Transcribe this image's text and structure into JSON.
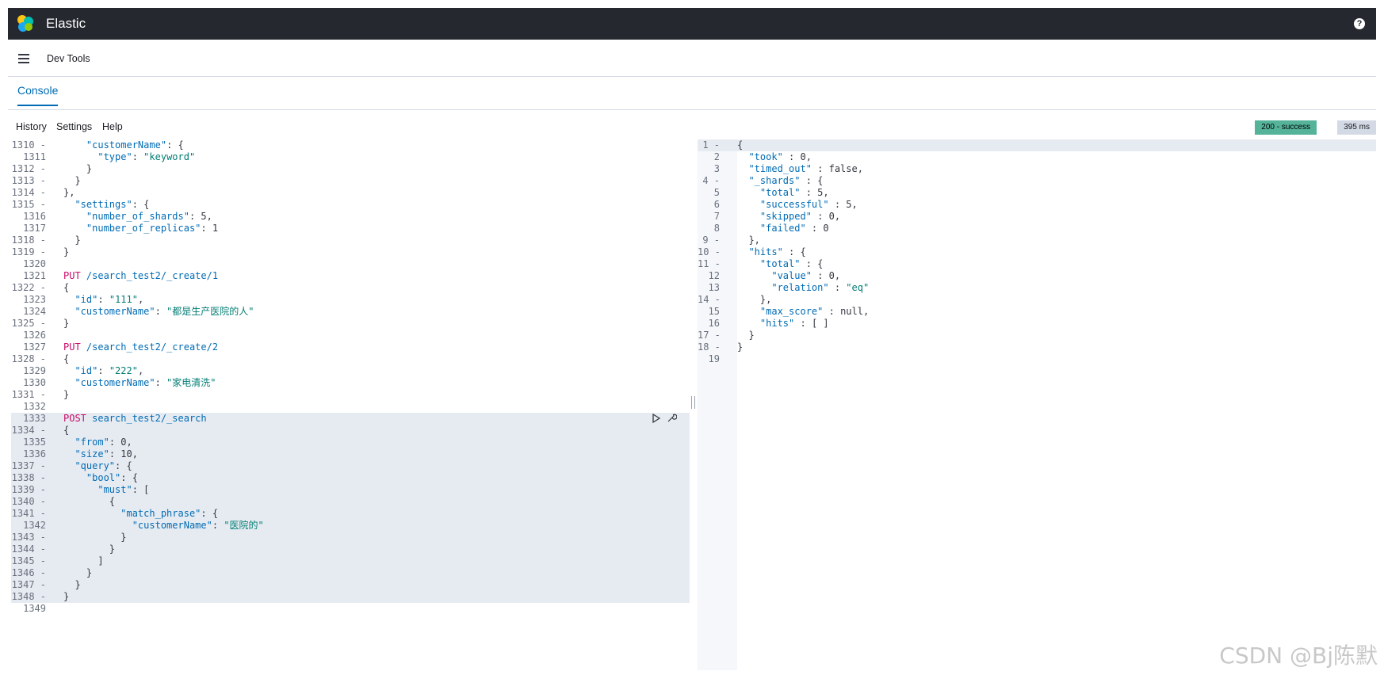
{
  "app": {
    "title": "Elastic"
  },
  "header": {
    "breadcrumb": "Dev Tools",
    "help_label": "?"
  },
  "tabs": [
    {
      "label": "Console",
      "active": true
    }
  ],
  "toolbar": {
    "history": "History",
    "settings": "Settings",
    "help": "Help",
    "status": "200 - success",
    "time": "395 ms"
  },
  "colors": {
    "topbar": "#25282f",
    "accent": "#006bb4",
    "status_bg": "#54b399",
    "method": "#c80a68",
    "string": "#017d73"
  },
  "icons": [
    "menu-icon",
    "elastic-logo",
    "help-icon",
    "run-request-icon",
    "wrench-icon"
  ],
  "editor": {
    "lines": [
      {
        "n": "1310 -",
        "t": "    \"customerName\": {"
      },
      {
        "n": "1311",
        "t": "      \"type\": \"keyword\""
      },
      {
        "n": "1312 -",
        "t": "    }"
      },
      {
        "n": "1313 -",
        "t": "  }"
      },
      {
        "n": "1314 -",
        "t": "},",
        "indent": 1
      },
      {
        "n": "1315 -",
        "t": "  \"settings\": {"
      },
      {
        "n": "1316",
        "t": "    \"number_of_shards\": 5,"
      },
      {
        "n": "1317",
        "t": "    \"number_of_replicas\": 1"
      },
      {
        "n": "1318 -",
        "t": "  }"
      },
      {
        "n": "1319 -",
        "t": "}"
      },
      {
        "n": "1320",
        "t": ""
      },
      {
        "n": "1321",
        "t": "PUT /search_test2/_create/1",
        "method": "PUT"
      },
      {
        "n": "1322 -",
        "t": "{"
      },
      {
        "n": "1323",
        "t": "  \"id\": \"111\","
      },
      {
        "n": "1324",
        "t": "  \"customerName\": \"都是生产医院的人\""
      },
      {
        "n": "1325 -",
        "t": "}"
      },
      {
        "n": "1326",
        "t": ""
      },
      {
        "n": "1327",
        "t": "PUT /search_test2/_create/2",
        "method": "PUT"
      },
      {
        "n": "1328 -",
        "t": "{"
      },
      {
        "n": "1329",
        "t": "  \"id\": \"222\","
      },
      {
        "n": "1330",
        "t": "  \"customerName\": \"家电清洗\""
      },
      {
        "n": "1331 -",
        "t": "}"
      },
      {
        "n": "1332",
        "t": ""
      },
      {
        "n": "1333",
        "t": "POST search_test2/_search",
        "method": "POST",
        "hl": true
      },
      {
        "n": "1334 -",
        "t": "{",
        "hl": true
      },
      {
        "n": "1335",
        "t": "  \"from\": 0,",
        "hl": true
      },
      {
        "n": "1336",
        "t": "  \"size\": 10,",
        "hl": true
      },
      {
        "n": "1337 -",
        "t": "  \"query\": {",
        "hl": true
      },
      {
        "n": "1338 -",
        "t": "    \"bool\": {",
        "hl": true
      },
      {
        "n": "1339 -",
        "t": "      \"must\": [",
        "hl": true
      },
      {
        "n": "1340 -",
        "t": "        {",
        "hl": true
      },
      {
        "n": "1341 -",
        "t": "          \"match_phrase\": {",
        "hl": true
      },
      {
        "n": "1342",
        "t": "            \"customerName\": \"医院的\"",
        "hl": true
      },
      {
        "n": "1343 -",
        "t": "          }",
        "hl": true
      },
      {
        "n": "1344 -",
        "t": "        }",
        "hl": true
      },
      {
        "n": "1345 -",
        "t": "      ]",
        "hl": true
      },
      {
        "n": "1346 -",
        "t": "    }",
        "hl": true
      },
      {
        "n": "1347 -",
        "t": "  }",
        "hl": true
      },
      {
        "n": "1348 -",
        "t": "}",
        "hl": true
      },
      {
        "n": "1349",
        "t": ""
      }
    ]
  },
  "output": {
    "lines": [
      {
        "n": "1 -",
        "t": "{",
        "hl": true
      },
      {
        "n": "2",
        "t": "  \"took\" : 0,"
      },
      {
        "n": "3",
        "t": "  \"timed_out\" : false,"
      },
      {
        "n": "4 -",
        "t": "  \"_shards\" : {"
      },
      {
        "n": "5",
        "t": "    \"total\" : 5,"
      },
      {
        "n": "6",
        "t": "    \"successful\" : 5,"
      },
      {
        "n": "7",
        "t": "    \"skipped\" : 0,"
      },
      {
        "n": "8",
        "t": "    \"failed\" : 0"
      },
      {
        "n": "9 -",
        "t": "  },"
      },
      {
        "n": "10 -",
        "t": "  \"hits\" : {"
      },
      {
        "n": "11 -",
        "t": "    \"total\" : {"
      },
      {
        "n": "12",
        "t": "      \"value\" : 0,"
      },
      {
        "n": "13",
        "t": "      \"relation\" : \"eq\""
      },
      {
        "n": "14 -",
        "t": "    },"
      },
      {
        "n": "15",
        "t": "    \"max_score\" : null,"
      },
      {
        "n": "16",
        "t": "    \"hits\" : [ ]"
      },
      {
        "n": "17 -",
        "t": "  }"
      },
      {
        "n": "18 -",
        "t": "}"
      },
      {
        "n": "19",
        "t": ""
      }
    ]
  },
  "watermark": "CSDN @Bj陈默"
}
